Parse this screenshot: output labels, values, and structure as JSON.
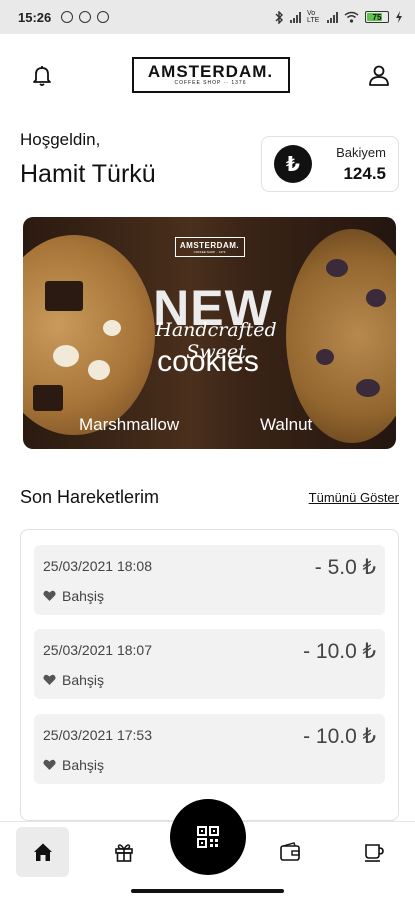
{
  "status_bar": {
    "time": "15:26",
    "network_label": "Vo LTE",
    "battery": "75",
    "battery_level": 0.75
  },
  "header": {
    "logo_main": "AMSTERDAM.",
    "logo_sub": "COFFEE SHOP ·· 1376",
    "left_icon": "bell-icon",
    "right_icon": "user-icon"
  },
  "greeting": {
    "hello": "Hoşgeldin,",
    "name": "Hamit Türkü"
  },
  "balance": {
    "label": "Bakiyem",
    "value": "124.5",
    "currency_symbol": "₺"
  },
  "banner": {
    "logo_main": "AMSTERDAM.",
    "logo_sub": "COFFEE SHOP ·· 1376",
    "headline": "NEW",
    "script": "Handcrafted Sweet",
    "product": "cookies",
    "left_label": "Marshmallow",
    "right_label": "Walnut"
  },
  "recent": {
    "title": "Son Hareketlerim",
    "show_all": "Tümünü Göster",
    "transactions": [
      {
        "date": "25/03/2021 18:08",
        "amount": "- 5.0 ₺",
        "type": "Bahşiş"
      },
      {
        "date": "25/03/2021 18:07",
        "amount": "- 10.0 ₺",
        "type": "Bahşiş"
      },
      {
        "date": "25/03/2021 17:53",
        "amount": "- 10.0 ₺",
        "type": "Bahşiş"
      }
    ]
  },
  "bottom_nav": {
    "items": [
      "home-icon",
      "gift-icon",
      "qr-code-icon",
      "wallet-icon",
      "coffee-cup-icon"
    ]
  }
}
